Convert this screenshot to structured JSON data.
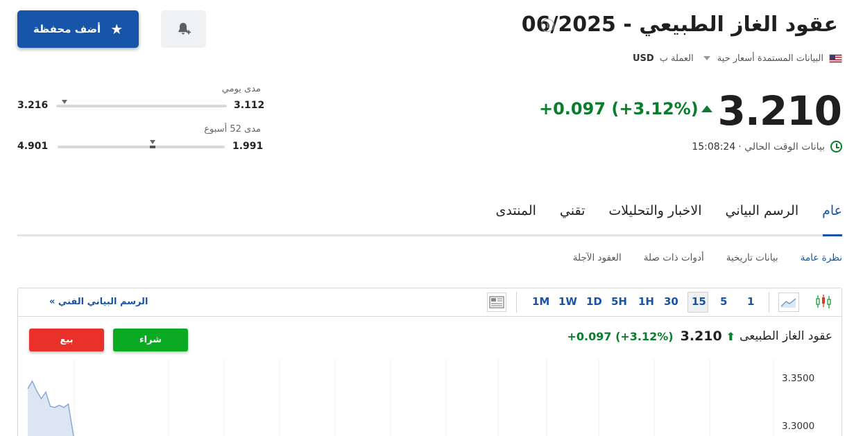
{
  "header": {
    "title": "عقود الغاز الطبيعي - 06/2025",
    "info_icon": "i",
    "data_source": "البيانات المستمدة أسعار حية",
    "currency_label": "العملة ب",
    "currency_code": "USD",
    "add_portfolio_label": "أضف محفظة"
  },
  "quote": {
    "price": "3.210",
    "change": "+0.097 (+3.12%)",
    "live_label": "بيانات الوقت الحالي ·",
    "live_time": "15:08:24"
  },
  "ranges": {
    "daily": {
      "label": "مدى يومي",
      "low": "3.112",
      "high": "3.216",
      "position": 0.95
    },
    "week52": {
      "label": "مدى 52 أسبوع",
      "low": "1.991",
      "high": "4.901",
      "position": 0.43
    }
  },
  "tabs": [
    {
      "label": "عام",
      "active": true
    },
    {
      "label": "الرسم البياني",
      "active": false
    },
    {
      "label": "الاخبار والتحليلات",
      "active": false
    },
    {
      "label": "تقني",
      "active": false
    },
    {
      "label": "المنتدى",
      "active": false
    }
  ],
  "subtabs": [
    {
      "label": "نظرة عامة",
      "active": true
    },
    {
      "label": "بيانات تاريخية",
      "active": false
    },
    {
      "label": "أدوات ذات صلة",
      "active": false
    },
    {
      "label": "العقود الآجلة",
      "active": false
    }
  ],
  "widget": {
    "timeframes": [
      "1",
      "5",
      "15",
      "30",
      "1H",
      "5H",
      "1D",
      "1W",
      "1M"
    ],
    "active_timeframe": "15",
    "tech_chart_link": "الرسم البياني الفني »",
    "instrument_name": "عقود الغاز الطبيعى",
    "price": "3.210",
    "change": "+0.097  (+3.12%)",
    "buy_label": "شراء",
    "sell_label": "بيع",
    "y_ticks": [
      "3.3500",
      "3.3000"
    ]
  },
  "colors": {
    "accent": "#1655a7",
    "positive": "#0a7d2c",
    "buy": "#0aab22",
    "sell": "#e8312a"
  },
  "chart_data": {
    "type": "area",
    "x": [
      0,
      1,
      2,
      3,
      4,
      5,
      6,
      7,
      8,
      9,
      10
    ],
    "y": [
      3.328,
      3.335,
      3.326,
      3.319,
      3.325,
      3.312,
      3.311,
      3.313,
      3.311,
      3.314,
      3.289
    ],
    "ylim": [
      3.285,
      3.355
    ],
    "y_ticks": [
      3.35,
      3.3
    ]
  }
}
